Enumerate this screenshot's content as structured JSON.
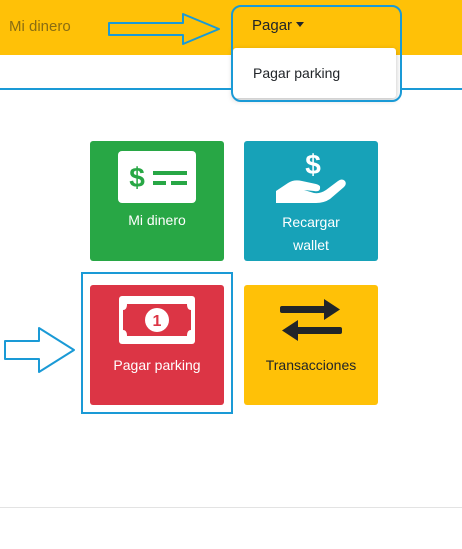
{
  "navbar": {
    "brand": "Mi dinero",
    "pagar_label": "Pagar",
    "dropdown_items": [
      "Pagar parking"
    ]
  },
  "cards": [
    {
      "label_lines": [
        "Mi dinero"
      ],
      "color": "#28a745",
      "icon": "money-check-icon"
    },
    {
      "label_lines": [
        "Recargar",
        "wallet"
      ],
      "color": "#17a2b8",
      "icon": "hand-holding-dollar-icon"
    },
    {
      "label_lines": [
        "Pagar parking"
      ],
      "color": "#dc3545",
      "icon": "money-bill-icon"
    },
    {
      "label_lines": [
        "Transacciones"
      ],
      "color": "#ffc107",
      "icon": "exchange-arrows-icon"
    }
  ],
  "colors": {
    "navbar": "#ffc107",
    "annotation": "#1a9ad6"
  }
}
